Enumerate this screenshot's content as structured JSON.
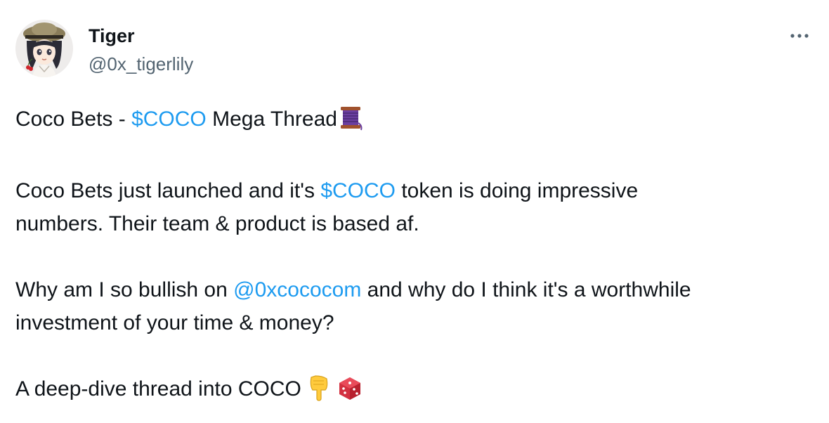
{
  "author": {
    "name": "Tiger",
    "handle": "@0x_tigerlily",
    "avatar_icon": "anime-girl-avatar-icon"
  },
  "menu": {
    "icon": "more-options-icon",
    "label": "···"
  },
  "tweet": {
    "p1": {
      "t1": "Coco Bets - ",
      "cashtag": "$COCO",
      "t2": " Mega Thread",
      "emoji": "thread-spool-icon"
    },
    "p2": {
      "t1": "Coco Bets just launched and it's ",
      "cashtag": "$COCO",
      "t2": " token is doing impressive",
      "line2": "numbers. Their team & product is based af."
    },
    "p3": {
      "t1": "Why am I so bullish on ",
      "mention": "@0xcococom",
      "t2": " and why do I think it's a worthwhile",
      "line2": "investment of your time & money?"
    },
    "p4": {
      "t1": "A deep-dive thread into COCO ",
      "emoji1": "pointing-down-hand-icon",
      "emoji2": "red-dice-icon"
    }
  },
  "colors": {
    "text": "#0f1419",
    "secondary": "#536471",
    "link": "#1d9bf0"
  }
}
